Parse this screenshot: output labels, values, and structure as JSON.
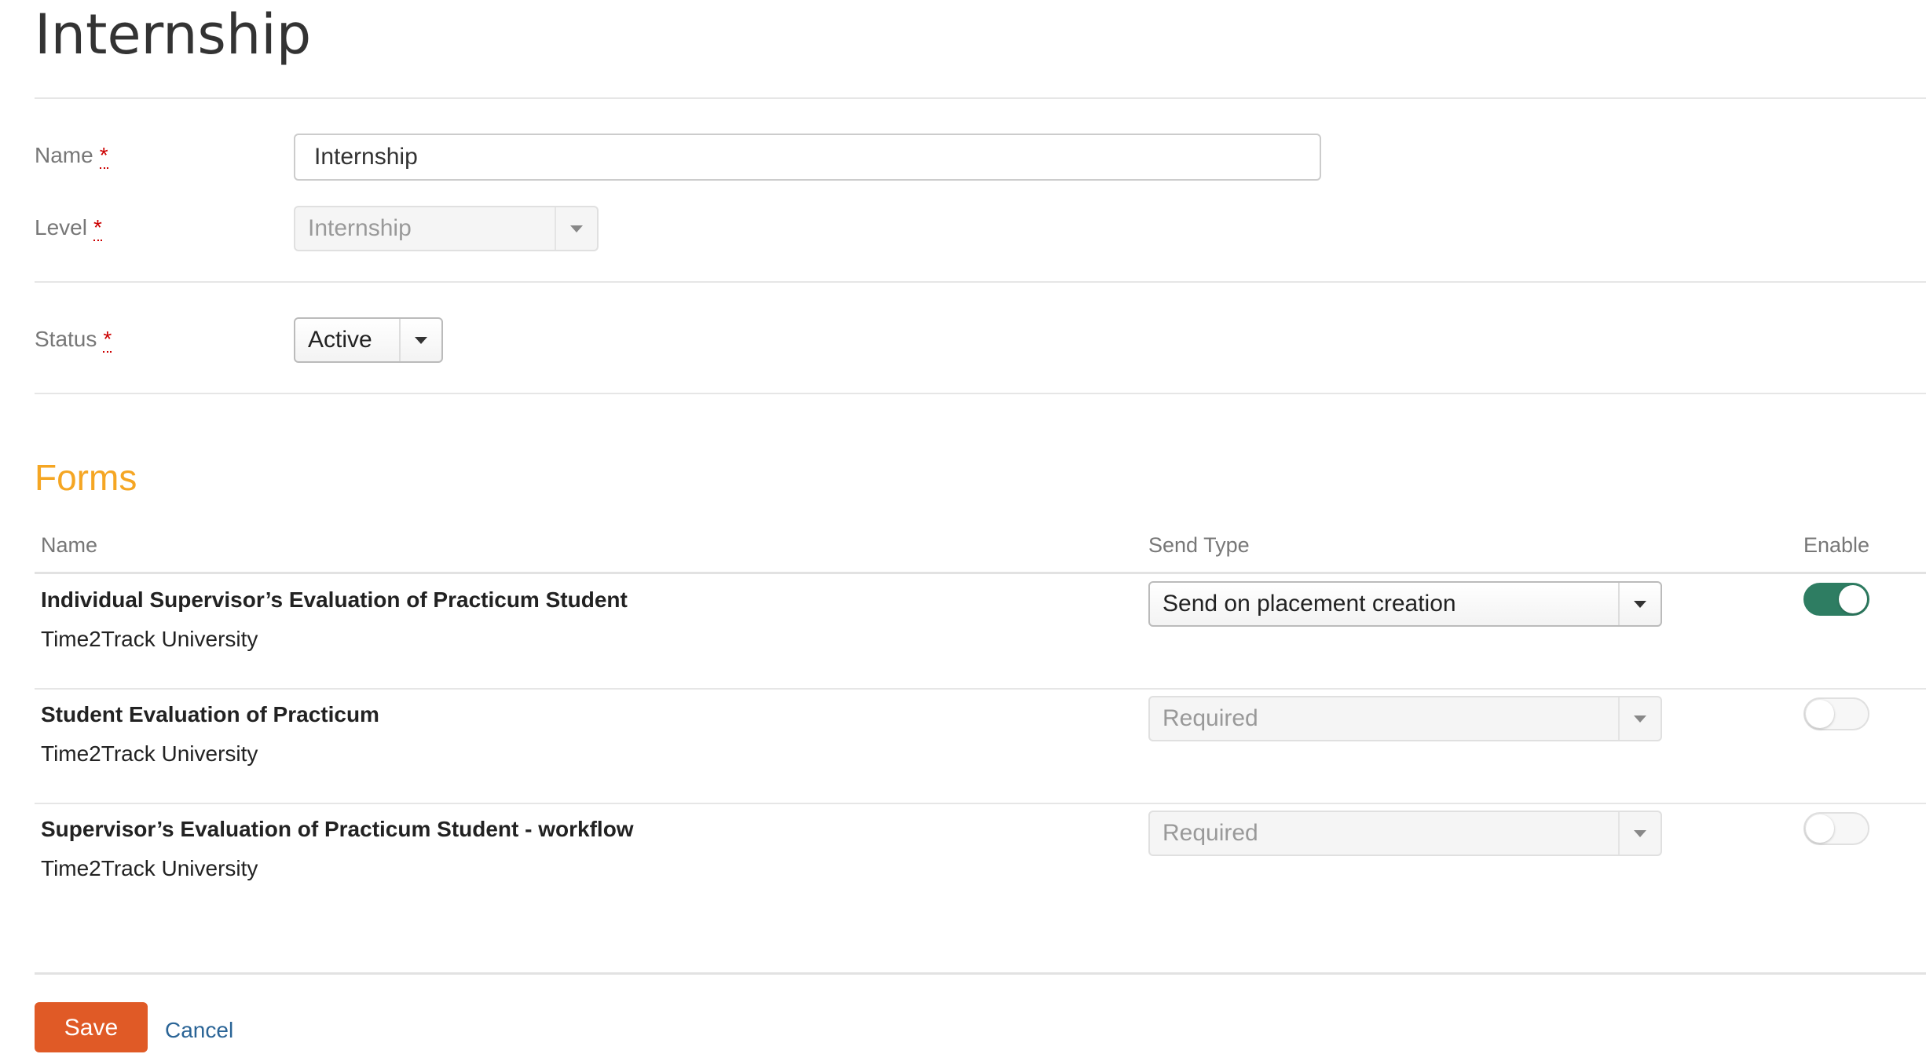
{
  "page": {
    "title": "Internship"
  },
  "fields": {
    "name": {
      "label": "Name",
      "required_mark": "*",
      "value": "Internship"
    },
    "level": {
      "label": "Level",
      "required_mark": "*",
      "selected": "Internship"
    },
    "status": {
      "label": "Status",
      "required_mark": "*",
      "selected": "Active"
    }
  },
  "forms_section": {
    "title": "Forms",
    "columns": {
      "name": "Name",
      "send_type": "Send Type",
      "enable": "Enable"
    },
    "rows": [
      {
        "name": "Individual Supervisor’s Evaluation of Practicum Student",
        "org": "Time2Track University",
        "send_type": "Send on placement creation",
        "enabled": true
      },
      {
        "name": "Student Evaluation of Practicum",
        "org": "Time2Track University",
        "send_type": "Required",
        "enabled": false
      },
      {
        "name": "Supervisor’s Evaluation of Practicum Student - workflow",
        "org": "Time2Track University",
        "send_type": "Required",
        "enabled": false
      }
    ]
  },
  "actions": {
    "save_label": "Save",
    "cancel_label": "Cancel"
  },
  "colors": {
    "accent_orange": "#f5a623",
    "save_button": "#e05a26",
    "toggle_on": "#2e7d62",
    "link": "#2a6496"
  },
  "icons": {
    "dropdown": "caret-down-icon"
  }
}
